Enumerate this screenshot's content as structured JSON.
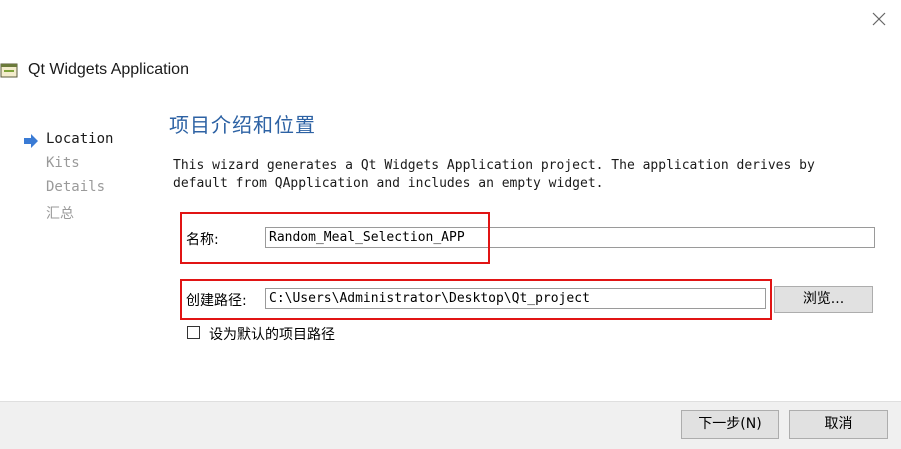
{
  "window": {
    "title": "Qt Widgets Application",
    "close_glyph": "✕"
  },
  "steps": [
    {
      "label": "Location",
      "active": true
    },
    {
      "label": "Kits",
      "active": false
    },
    {
      "label": "Details",
      "active": false
    },
    {
      "label": "汇总",
      "active": false
    }
  ],
  "page": {
    "title": "项目介绍和位置",
    "description": "This wizard generates a Qt Widgets Application project. The application derives by default from QApplication and includes an empty widget."
  },
  "form": {
    "name_label": "名称:",
    "name_value": "Random_Meal_Selection_APP",
    "path_label": "创建路径:",
    "path_value": "C:\\Users\\Administrator\\Desktop\\Qt_project",
    "browse_label": "浏览...",
    "default_path_label": "设为默认的项目路径",
    "default_path_checked": false
  },
  "footer": {
    "next_label": "下一步(N)",
    "cancel_label": "取消"
  },
  "colors": {
    "accent": "#2d62a4",
    "highlight_box": "#e11414",
    "step_arrow": "#3a7bd5"
  }
}
